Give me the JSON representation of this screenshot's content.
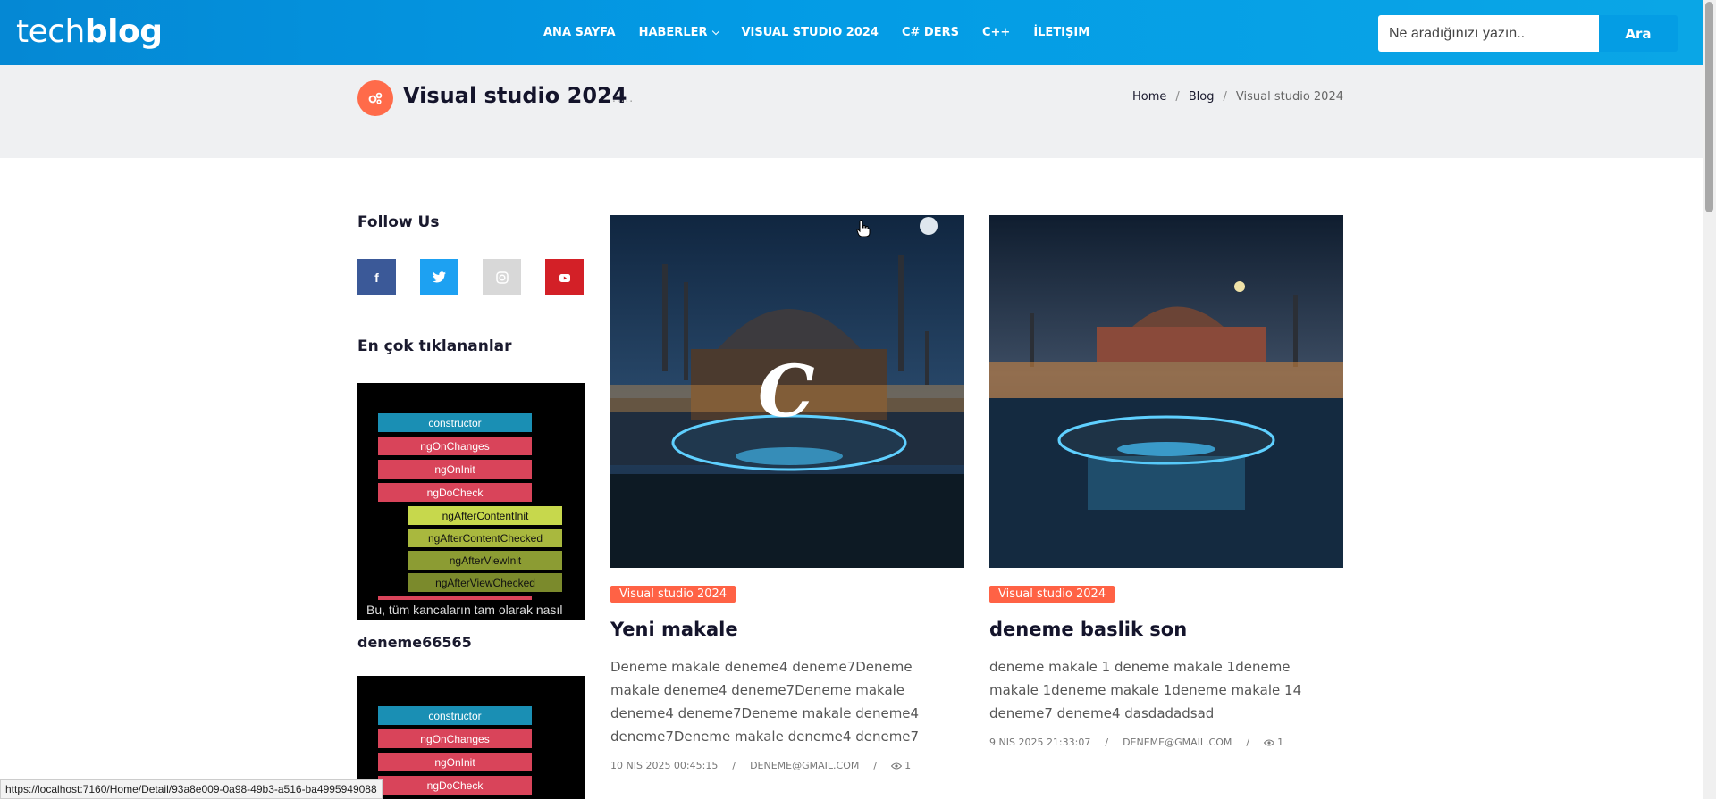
{
  "brand": {
    "light": "tech",
    "bold": "blog"
  },
  "nav": {
    "home": "ANA SAYFA",
    "news": "HABERLER",
    "vs": "VISUAL STUDIO 2024",
    "csharp": "C# DERS",
    "cpp": "C++",
    "contact": "İLETIŞIM"
  },
  "search": {
    "placeholder": "Ne aradığınızı yazın..",
    "button": "Ara"
  },
  "page": {
    "title": "Visual studio 2024",
    "dots": ".....",
    "breadcrumb": [
      "Home",
      "Blog",
      "Visual studio 2024"
    ]
  },
  "sidebar": {
    "follow_title": "Follow Us",
    "social_icons": [
      "facebook-icon",
      "twitter-icon",
      "instagram-icon",
      "youtube-icon"
    ],
    "popular_title": "En çok tıklananlar",
    "hooks": [
      "constructor",
      "ngOnChanges",
      "ngOnInit",
      "ngDoCheck",
      "ngAfterContentInit",
      "ngAfterContentChecked",
      "ngAfterViewInit",
      "ngAfterViewChecked"
    ],
    "thumb_caption": "Bu, tüm kancaların tam olarak nasıl",
    "popular_name": "deneme66565"
  },
  "articles": [
    {
      "category": "Visual studio 2024",
      "title": "Yeni makale",
      "excerpt": "Deneme makale deneme4 deneme7Deneme makale deneme4 deneme7Deneme makale deneme4 deneme7Deneme makale deneme4 deneme7Deneme makale deneme4 deneme7",
      "date": "10 NIS 2025 00:45:15",
      "author": "DENEME@GMAIL.COM",
      "views": "1"
    },
    {
      "category": "Visual studio 2024",
      "title": "deneme baslik son",
      "excerpt": "deneme makale 1 deneme makale 1deneme makale 1deneme makale 1deneme makale 14 deneme7 deneme4 dasdadadsad",
      "date": "9 NIS 2025 21:33:07",
      "author": "DENEME@GMAIL.COM",
      "views": "1"
    }
  ],
  "status_url": "https://localhost:7160/Home/Detail/93a8e009-0a98-49b3-a516-ba4995949088",
  "colors": {
    "header": "#039be5",
    "accent": "#ff6245",
    "facebook": "#3b5998",
    "twitter": "#1da1f2",
    "instagram": "#d8d8d8",
    "youtube": "#d32027"
  }
}
